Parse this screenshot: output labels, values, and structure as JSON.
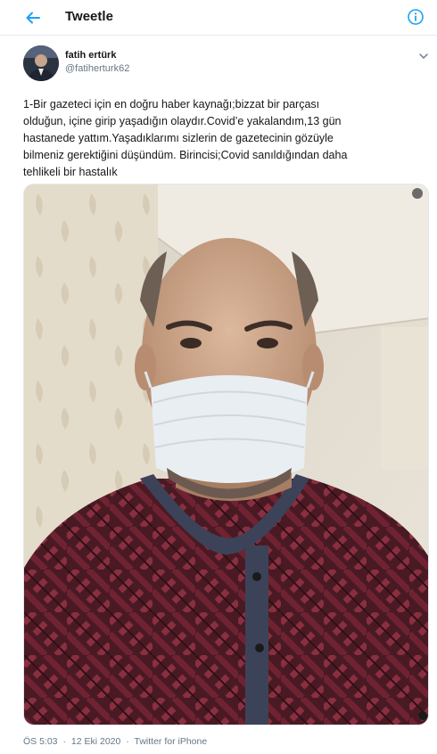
{
  "header": {
    "title": "Tweetle",
    "back_icon": "arrow-left-icon",
    "info_icon": "info-icon"
  },
  "colors": {
    "accent": "#1da1f2",
    "text": "#14171a",
    "muted": "#657786",
    "border": "#e6ecf0"
  },
  "author": {
    "name": "fatih ertürk",
    "handle": "@fatiherturk62",
    "menu_icon": "chevron-down-icon"
  },
  "tweet": {
    "lines": [
      "1-Bir gazeteci için en doğru haber kaynağı;bizzat bir parçası",
      "olduğun, içine girip yaşadığın olaydır.Covid’e yakalandım,13 gün",
      "hastanede yattım.Yaşadıklarımı sizlerin de gazetecinin gözüyle",
      "bilmeniz gerektiğini düşündüm. Birincisi;Covid sanıldığından daha",
      "tehlikeli bir hastalık"
    ]
  },
  "meta": {
    "time": "ÖS 5:03",
    "date": "12 Eki 2020",
    "source": "Twitter for iPhone",
    "separator": "·"
  }
}
